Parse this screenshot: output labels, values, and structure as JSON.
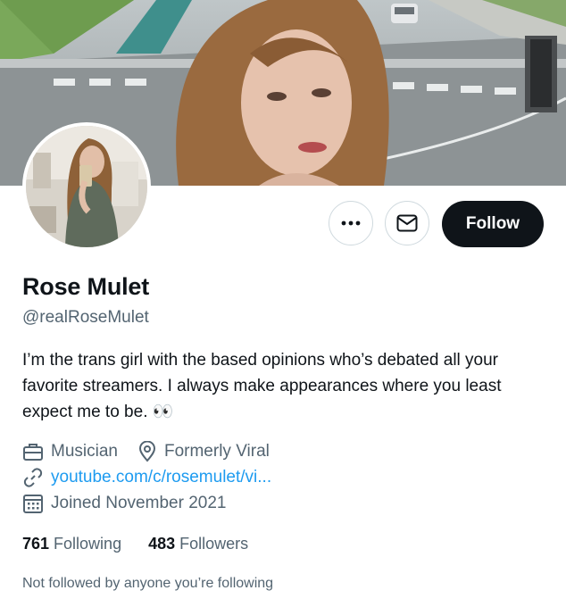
{
  "profile": {
    "name": "Rose Mulet",
    "handle": "@realRoseMulet",
    "bio": "I’m the trans girl with the based opinions who’s debated all your favorite streamers. I always make appearances where you least expect me to be.",
    "bio_emoji": "👀",
    "category": "Musician",
    "location": "Formerly Viral",
    "link": "youtube.com/c/rosemulet/vi...",
    "joined": "Joined November 2021",
    "following_count": "761",
    "following_label": "Following",
    "followers_count": "483",
    "followers_label": "Followers",
    "followed_by_note": "Not followed by anyone you’re following"
  },
  "actions": {
    "follow_label": "Follow",
    "more_icon": "more-dots-icon",
    "message_icon": "envelope-icon"
  },
  "colors": {
    "text": "#0f1419",
    "secondary": "#536471",
    "link": "#1d9bf0",
    "follow_bg": "#0f1419"
  }
}
